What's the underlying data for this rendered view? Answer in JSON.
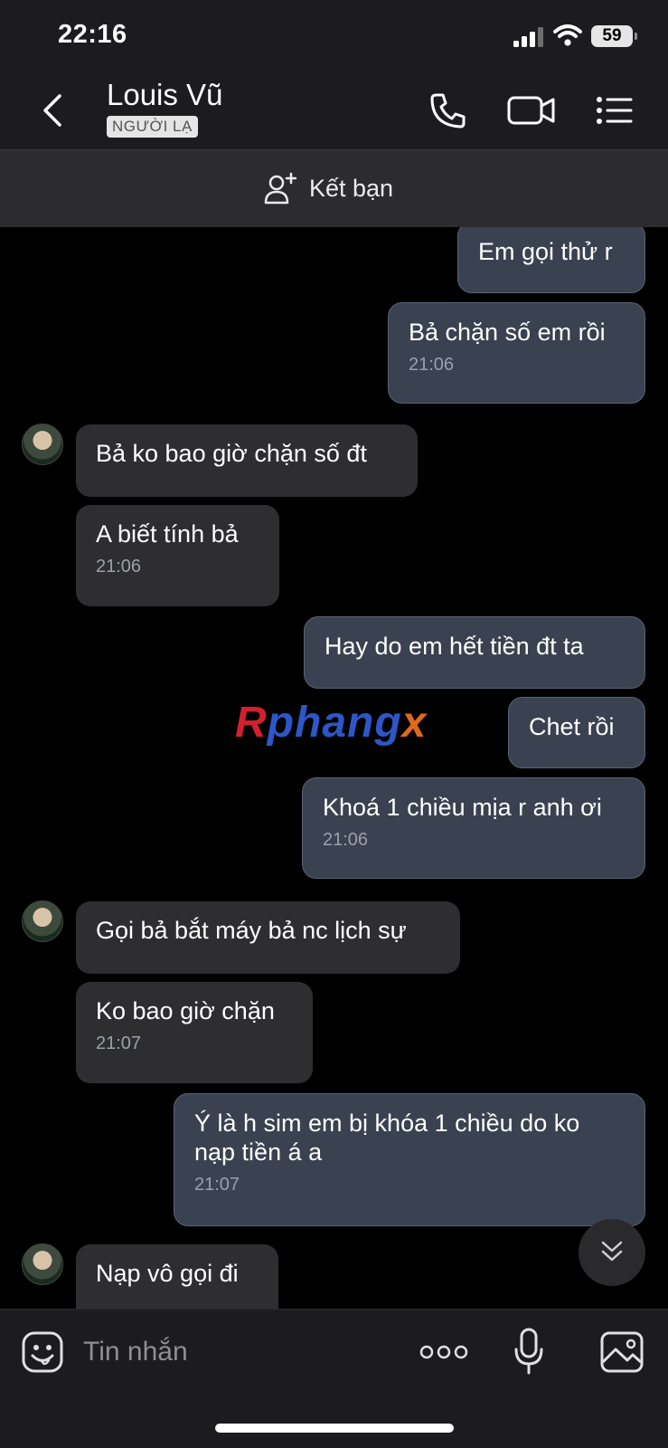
{
  "status": {
    "time": "22:16",
    "battery": "59"
  },
  "header": {
    "name": "Louis Vũ",
    "badge": "NGƯỜI LẠ"
  },
  "add_friend": {
    "label": "Kết bạn"
  },
  "messages": [
    {
      "dir": "out",
      "text": "Em gọi thử r",
      "time": ""
    },
    {
      "dir": "out",
      "text": "Bả chặn số em rồi",
      "time": "21:06"
    },
    {
      "dir": "in",
      "text": "Bả ko bao giờ chặn số đt",
      "time": ""
    },
    {
      "dir": "in",
      "text": "A biết tính bả",
      "time": "21:06"
    },
    {
      "dir": "out",
      "text": "Hay do em hết tiền đt ta",
      "time": ""
    },
    {
      "dir": "out",
      "text": "Chet rồi",
      "time": ""
    },
    {
      "dir": "out",
      "text": "Khoá 1 chiều mịa r anh ơi",
      "time": "21:06"
    },
    {
      "dir": "in",
      "text": "Gọi bả bắt máy bả nc lịch sự",
      "time": ""
    },
    {
      "dir": "in",
      "text": "Ko bao giờ chặn",
      "time": "21:07"
    },
    {
      "dir": "out",
      "text": "Ý là h sim em bị khóa 1 chiều do ko nạp tiền á a",
      "time": "21:07"
    },
    {
      "dir": "in",
      "text": "Nạp vô gọi đi",
      "time": ""
    }
  ],
  "watermark": {
    "part1": "R",
    "part2": "phang",
    "part3": "x"
  },
  "composer": {
    "placeholder": "Tin nhắn"
  },
  "icons": {
    "back": "chevron-left-icon",
    "call": "phone-icon",
    "video": "video-camera-icon",
    "menu": "list-menu-icon",
    "add_friend": "person-add-icon",
    "scroll": "chevrons-down-icon",
    "emoji": "emoji-icon",
    "more": "more-dots-icon",
    "mic": "microphone-icon",
    "image": "image-icon"
  },
  "colors": {
    "outgoing_bubble": "#3a4150",
    "incoming_bubble": "#2e2e30",
    "header_bg": "#1c1c1e"
  }
}
